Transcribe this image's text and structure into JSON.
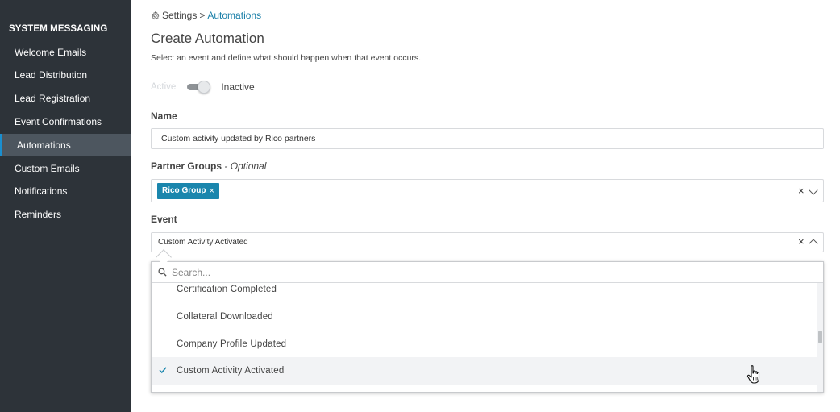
{
  "sidebar": {
    "heading": "SYSTEM MESSAGING",
    "items": [
      {
        "label": "Welcome Emails"
      },
      {
        "label": "Lead Distribution"
      },
      {
        "label": "Lead Registration"
      },
      {
        "label": "Event Confirmations"
      },
      {
        "label": "Automations",
        "active": true
      },
      {
        "label": "Custom Emails"
      },
      {
        "label": "Notifications"
      },
      {
        "label": "Reminders"
      }
    ]
  },
  "breadcrumb": {
    "root": "Settings",
    "separator": ">",
    "current": "Automations"
  },
  "page": {
    "title": "Create Automation",
    "description": "Select an event and define what should happen when that event occurs."
  },
  "status_toggle": {
    "active_label": "Active",
    "inactive_label": "Inactive",
    "state": "inactive"
  },
  "form": {
    "name": {
      "label": "Name",
      "value": "Custom activity updated by Rico partners"
    },
    "partner_groups": {
      "label": "Partner Groups",
      "optional": "- Optional",
      "chips": [
        {
          "label": "Rico Group",
          "remove": "×"
        }
      ],
      "clear": "×"
    },
    "event": {
      "label": "Event",
      "value": "Custom Activity Activated",
      "clear": "×",
      "dropdown": {
        "search_placeholder": "Search...",
        "options": [
          {
            "label": "Certification Completed"
          },
          {
            "label": "Collateral Downloaded"
          },
          {
            "label": "Company Profile Updated"
          },
          {
            "label": "Custom Activity Activated",
            "selected": true
          }
        ]
      }
    }
  },
  "colors": {
    "sidebar_bg": "#2d3339",
    "sidebar_active_bg": "#4d565f",
    "accent": "#1a86ad",
    "link": "#1a7fa8"
  }
}
